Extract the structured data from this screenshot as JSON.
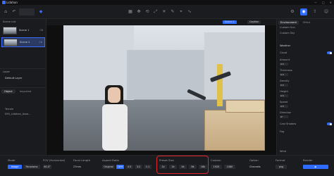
{
  "app": {
    "title": "Lidahan"
  },
  "window": {
    "minimize": "—",
    "maximize": "□",
    "close": "✕"
  },
  "toolbar": {
    "left_icons": [
      "home-icon",
      "undo-icon",
      "redo-icon",
      "grid-icon",
      "select-icon",
      "move-icon",
      "rotate-icon",
      "scale-icon"
    ],
    "right_icons": [
      "settings-icon",
      "camera-icon",
      "share-icon",
      "user-icon"
    ]
  },
  "left_panel": {
    "scene_list_title": "Scene List",
    "scenes": [
      {
        "label": "Scene 1",
        "badge": "C6"
      },
      {
        "label": "Scene 2",
        "badge": "C6"
      }
    ],
    "layer_title": "Layer",
    "default_layer": "Default Layer",
    "tabs": [
      "Object",
      "Imported"
    ],
    "tree_items": [
      "Terrain",
      "090_Lidahan_Asse..."
    ]
  },
  "viewport": {
    "buttons": [
      "Scene 2",
      "Caption"
    ]
  },
  "right_panel": {
    "tabs": [
      "Environment",
      "Effect"
    ],
    "section1": "Custom Sun",
    "section2": "Custom Sky",
    "weather_title": "Weather",
    "cloud_label": "Cloud",
    "props": [
      {
        "label": "Amount",
        "value": "0.5"
      },
      {
        "label": "Thickness",
        "value": "0.5"
      },
      {
        "label": "Density",
        "value": "0.5"
      },
      {
        "label": "Height",
        "value": "0.5"
      },
      {
        "label": "Speed",
        "value": "0.5"
      },
      {
        "label": "Direction",
        "value": "0°"
      }
    ],
    "cast_shadow": "Cast Shadow",
    "fog": "Fog",
    "wind": "Wind"
  },
  "bottom": {
    "mode_label": "Mode",
    "mode_buttons": [
      "Image",
      "Panorama"
    ],
    "fov_label": "FOV (Horizontal)",
    "fov_value": "60.0°",
    "focal_label": "Focal Length",
    "focal_value": "27mm",
    "aspect_label": "Aspect Ratio",
    "aspect_buttons": [
      "Original",
      "16:9",
      "4:3",
      "3:2",
      "1:1"
    ],
    "preset_label": "Preset Size",
    "preset_buttons": [
      "1k",
      "2k",
      "4k",
      "8k",
      "16k"
    ],
    "custom_label": "Custom",
    "custom_w": "1920",
    "custom_h": "1080",
    "option_label": "Option",
    "option_value": "Channels",
    "format_label": "Format",
    "format_value": "png",
    "render_label": "Render"
  },
  "colors": {
    "accent": "#2f6bff",
    "highlight_outline": "#e0262e"
  }
}
